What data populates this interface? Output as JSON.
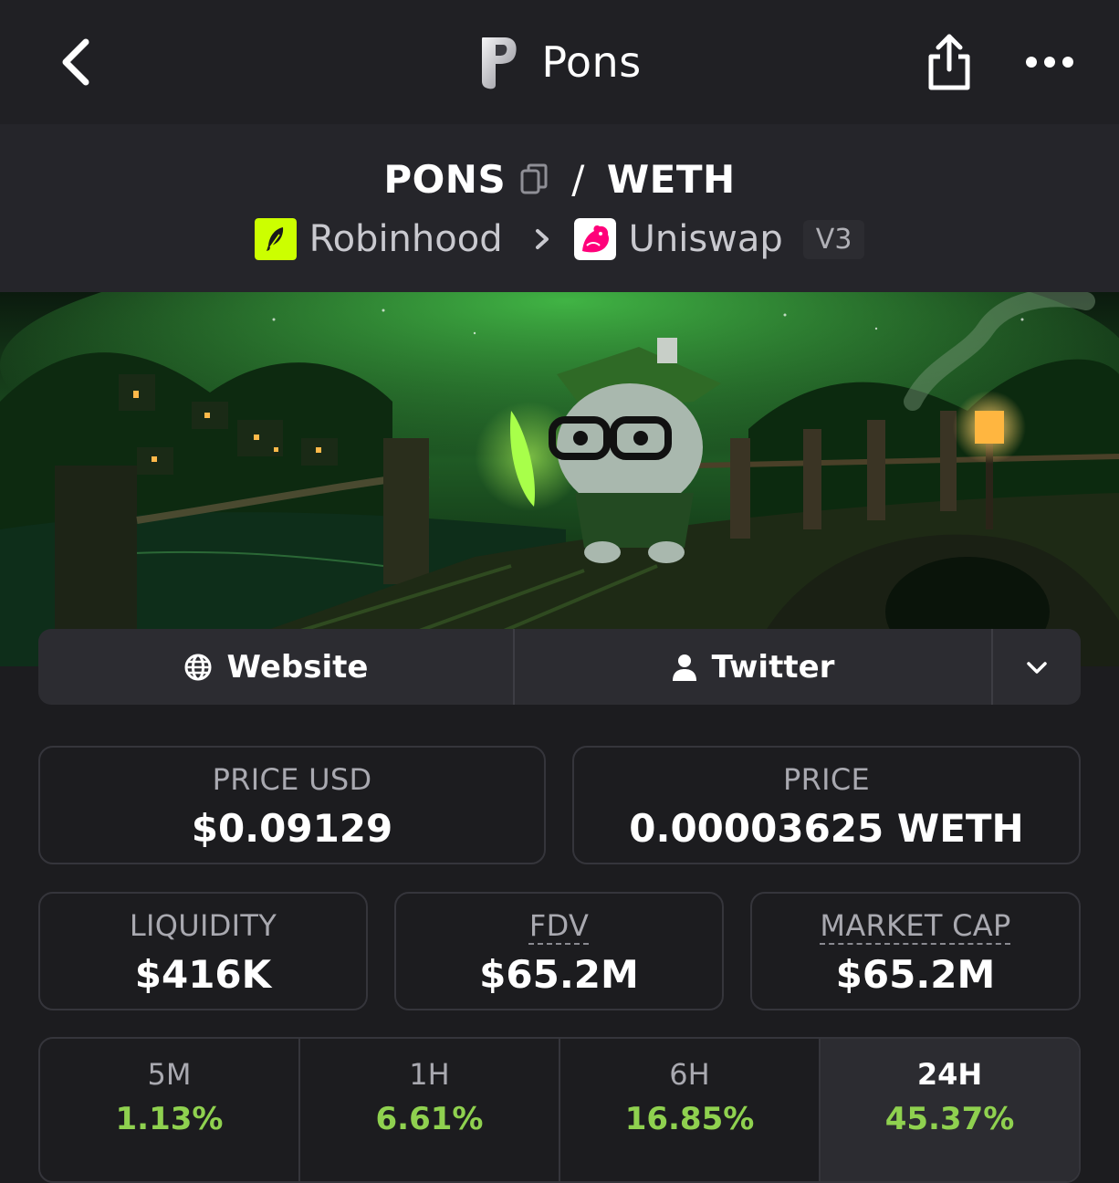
{
  "header": {
    "title": "Pons",
    "back_icon": "chevron-left-icon",
    "share_icon": "share-icon",
    "more_icon": "more-horizontal-icon"
  },
  "pair": {
    "base": "PONS",
    "separator": "/",
    "quote": "WETH",
    "chain": "Robinhood",
    "dex": "Uniswap",
    "version": "V3"
  },
  "links": {
    "website": "Website",
    "twitter": "Twitter"
  },
  "stats": {
    "price_usd_label": "PRICE USD",
    "price_usd": "$0.09129",
    "price_label": "PRICE",
    "price": "0.00003625 WETH",
    "liquidity_label": "LIQUIDITY",
    "liquidity": "$416K",
    "fdv_label": "FDV",
    "fdv": "$65.2M",
    "mcap_label": "MARKET CAP",
    "mcap": "$65.2M"
  },
  "changes": [
    {
      "tf": "5M",
      "pct": "1.13%"
    },
    {
      "tf": "1H",
      "pct": "6.61%"
    },
    {
      "tf": "6H",
      "pct": "16.85%"
    },
    {
      "tf": "24H",
      "pct": "45.37%",
      "selected": true
    }
  ],
  "colors": {
    "background": "#1c1c1f",
    "positive": "#8fd14f",
    "chain_brand": "#ccff00",
    "dex_brand": "#ff007a"
  }
}
